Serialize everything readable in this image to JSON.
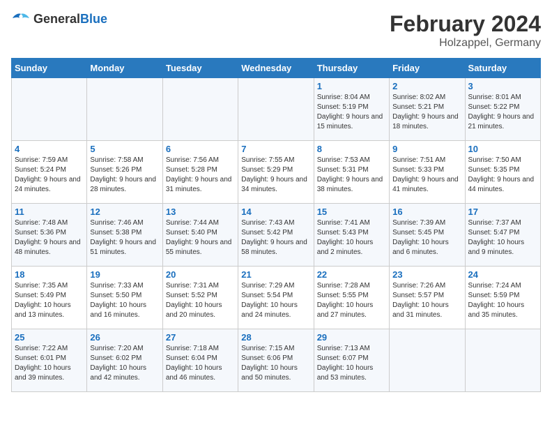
{
  "logo": {
    "general": "General",
    "blue": "Blue"
  },
  "header": {
    "title": "February 2024",
    "subtitle": "Holzappel, Germany"
  },
  "weekdays": [
    "Sunday",
    "Monday",
    "Tuesday",
    "Wednesday",
    "Thursday",
    "Friday",
    "Saturday"
  ],
  "rows": [
    [
      {
        "day": "",
        "sunrise": "",
        "sunset": "",
        "daylight": ""
      },
      {
        "day": "",
        "sunrise": "",
        "sunset": "",
        "daylight": ""
      },
      {
        "day": "",
        "sunrise": "",
        "sunset": "",
        "daylight": ""
      },
      {
        "day": "",
        "sunrise": "",
        "sunset": "",
        "daylight": ""
      },
      {
        "day": "1",
        "sunrise": "Sunrise: 8:04 AM",
        "sunset": "Sunset: 5:19 PM",
        "daylight": "Daylight: 9 hours and 15 minutes."
      },
      {
        "day": "2",
        "sunrise": "Sunrise: 8:02 AM",
        "sunset": "Sunset: 5:21 PM",
        "daylight": "Daylight: 9 hours and 18 minutes."
      },
      {
        "day": "3",
        "sunrise": "Sunrise: 8:01 AM",
        "sunset": "Sunset: 5:22 PM",
        "daylight": "Daylight: 9 hours and 21 minutes."
      }
    ],
    [
      {
        "day": "4",
        "sunrise": "Sunrise: 7:59 AM",
        "sunset": "Sunset: 5:24 PM",
        "daylight": "Daylight: 9 hours and 24 minutes."
      },
      {
        "day": "5",
        "sunrise": "Sunrise: 7:58 AM",
        "sunset": "Sunset: 5:26 PM",
        "daylight": "Daylight: 9 hours and 28 minutes."
      },
      {
        "day": "6",
        "sunrise": "Sunrise: 7:56 AM",
        "sunset": "Sunset: 5:28 PM",
        "daylight": "Daylight: 9 hours and 31 minutes."
      },
      {
        "day": "7",
        "sunrise": "Sunrise: 7:55 AM",
        "sunset": "Sunset: 5:29 PM",
        "daylight": "Daylight: 9 hours and 34 minutes."
      },
      {
        "day": "8",
        "sunrise": "Sunrise: 7:53 AM",
        "sunset": "Sunset: 5:31 PM",
        "daylight": "Daylight: 9 hours and 38 minutes."
      },
      {
        "day": "9",
        "sunrise": "Sunrise: 7:51 AM",
        "sunset": "Sunset: 5:33 PM",
        "daylight": "Daylight: 9 hours and 41 minutes."
      },
      {
        "day": "10",
        "sunrise": "Sunrise: 7:50 AM",
        "sunset": "Sunset: 5:35 PM",
        "daylight": "Daylight: 9 hours and 44 minutes."
      }
    ],
    [
      {
        "day": "11",
        "sunrise": "Sunrise: 7:48 AM",
        "sunset": "Sunset: 5:36 PM",
        "daylight": "Daylight: 9 hours and 48 minutes."
      },
      {
        "day": "12",
        "sunrise": "Sunrise: 7:46 AM",
        "sunset": "Sunset: 5:38 PM",
        "daylight": "Daylight: 9 hours and 51 minutes."
      },
      {
        "day": "13",
        "sunrise": "Sunrise: 7:44 AM",
        "sunset": "Sunset: 5:40 PM",
        "daylight": "Daylight: 9 hours and 55 minutes."
      },
      {
        "day": "14",
        "sunrise": "Sunrise: 7:43 AM",
        "sunset": "Sunset: 5:42 PM",
        "daylight": "Daylight: 9 hours and 58 minutes."
      },
      {
        "day": "15",
        "sunrise": "Sunrise: 7:41 AM",
        "sunset": "Sunset: 5:43 PM",
        "daylight": "Daylight: 10 hours and 2 minutes."
      },
      {
        "day": "16",
        "sunrise": "Sunrise: 7:39 AM",
        "sunset": "Sunset: 5:45 PM",
        "daylight": "Daylight: 10 hours and 6 minutes."
      },
      {
        "day": "17",
        "sunrise": "Sunrise: 7:37 AM",
        "sunset": "Sunset: 5:47 PM",
        "daylight": "Daylight: 10 hours and 9 minutes."
      }
    ],
    [
      {
        "day": "18",
        "sunrise": "Sunrise: 7:35 AM",
        "sunset": "Sunset: 5:49 PM",
        "daylight": "Daylight: 10 hours and 13 minutes."
      },
      {
        "day": "19",
        "sunrise": "Sunrise: 7:33 AM",
        "sunset": "Sunset: 5:50 PM",
        "daylight": "Daylight: 10 hours and 16 minutes."
      },
      {
        "day": "20",
        "sunrise": "Sunrise: 7:31 AM",
        "sunset": "Sunset: 5:52 PM",
        "daylight": "Daylight: 10 hours and 20 minutes."
      },
      {
        "day": "21",
        "sunrise": "Sunrise: 7:29 AM",
        "sunset": "Sunset: 5:54 PM",
        "daylight": "Daylight: 10 hours and 24 minutes."
      },
      {
        "day": "22",
        "sunrise": "Sunrise: 7:28 AM",
        "sunset": "Sunset: 5:55 PM",
        "daylight": "Daylight: 10 hours and 27 minutes."
      },
      {
        "day": "23",
        "sunrise": "Sunrise: 7:26 AM",
        "sunset": "Sunset: 5:57 PM",
        "daylight": "Daylight: 10 hours and 31 minutes."
      },
      {
        "day": "24",
        "sunrise": "Sunrise: 7:24 AM",
        "sunset": "Sunset: 5:59 PM",
        "daylight": "Daylight: 10 hours and 35 minutes."
      }
    ],
    [
      {
        "day": "25",
        "sunrise": "Sunrise: 7:22 AM",
        "sunset": "Sunset: 6:01 PM",
        "daylight": "Daylight: 10 hours and 39 minutes."
      },
      {
        "day": "26",
        "sunrise": "Sunrise: 7:20 AM",
        "sunset": "Sunset: 6:02 PM",
        "daylight": "Daylight: 10 hours and 42 minutes."
      },
      {
        "day": "27",
        "sunrise": "Sunrise: 7:18 AM",
        "sunset": "Sunset: 6:04 PM",
        "daylight": "Daylight: 10 hours and 46 minutes."
      },
      {
        "day": "28",
        "sunrise": "Sunrise: 7:15 AM",
        "sunset": "Sunset: 6:06 PM",
        "daylight": "Daylight: 10 hours and 50 minutes."
      },
      {
        "day": "29",
        "sunrise": "Sunrise: 7:13 AM",
        "sunset": "Sunset: 6:07 PM",
        "daylight": "Daylight: 10 hours and 53 minutes."
      },
      {
        "day": "",
        "sunrise": "",
        "sunset": "",
        "daylight": ""
      },
      {
        "day": "",
        "sunrise": "",
        "sunset": "",
        "daylight": ""
      }
    ]
  ]
}
